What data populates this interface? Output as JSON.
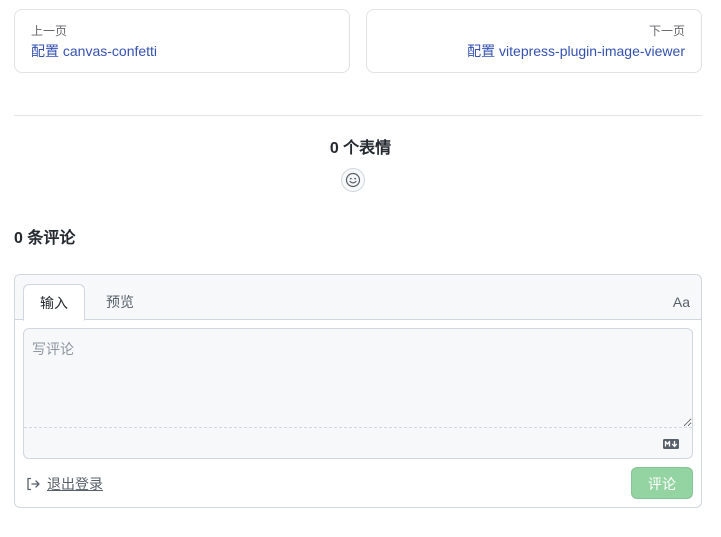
{
  "pager": {
    "prev": {
      "desc": "上一页",
      "title": "配置 canvas-confetti"
    },
    "next": {
      "desc": "下一页",
      "title": "配置 vitepress-plugin-image-viewer"
    }
  },
  "reactions": {
    "title": "0 个表情",
    "button_icon": "smiley-icon"
  },
  "comments": {
    "count_label": "0 条评论"
  },
  "editor": {
    "tabs": [
      {
        "label": "输入",
        "active": true
      },
      {
        "label": "预览",
        "active": false
      }
    ],
    "font_toggle": "Aa",
    "placeholder": "写评论",
    "markdown_icon": "markdown-icon",
    "signout_icon": "sign-out-icon",
    "signout_label": "退出登录",
    "submit_label": "评论"
  },
  "colors": {
    "link": "#3451b2",
    "submit_disabled": "#94d3a2",
    "border": "#d0d7de"
  }
}
